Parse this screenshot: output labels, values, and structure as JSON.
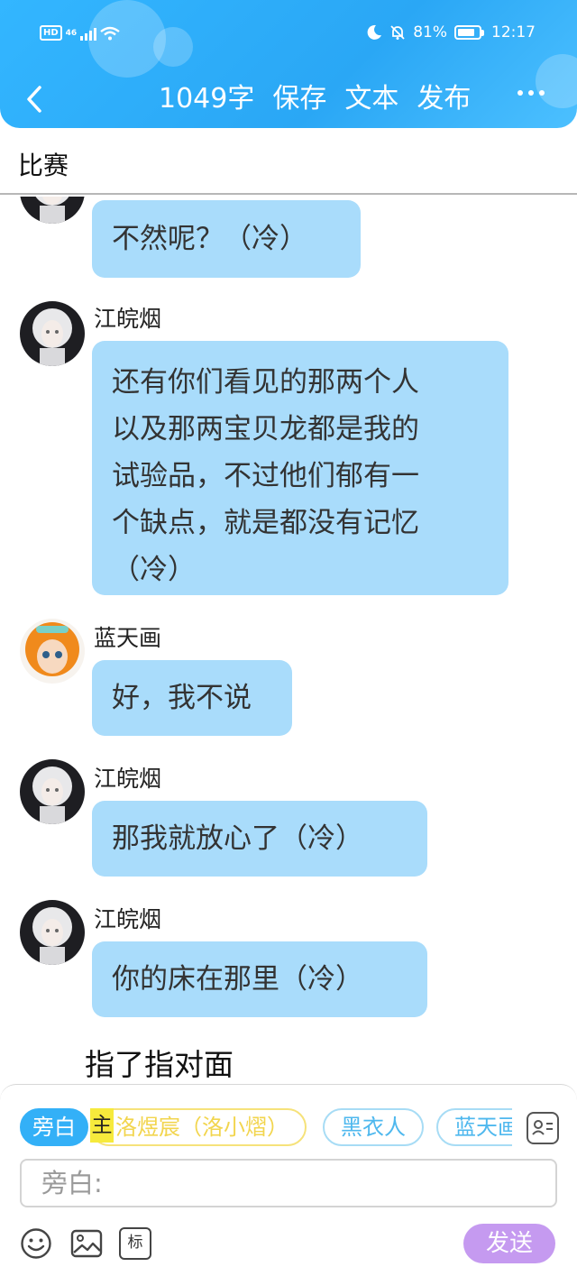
{
  "status_bar": {
    "hd": "HD",
    "network": "46",
    "battery_percent": "81%",
    "battery_level": 0.81,
    "time": "12:17"
  },
  "toolbar": {
    "word_count": "1049字",
    "save_label": "保存",
    "text_label": "文本",
    "publish_label": "发布"
  },
  "page_title": "比赛",
  "messages": [
    {
      "name": "",
      "text": "不然呢？（冷）"
    },
    {
      "name": "江皖烟",
      "lines": [
        "还有你们看见的那两个人",
        "以及那两宝贝龙都是我的",
        "试验品，不过他们郁有一",
        "个缺点，就是都没有记忆",
        "（冷）"
      ]
    },
    {
      "name": "蓝天画",
      "text": "好，我不说"
    },
    {
      "name": "江皖烟",
      "text": "那我就放心了（冷）"
    },
    {
      "name": "江皖烟",
      "text": "你的床在那里（冷）"
    }
  ],
  "narration": "指了指对面",
  "input_panel": {
    "roles": {
      "active": "旁白",
      "main_tag": "主",
      "main_role": "洛煜宸（洛小熠）",
      "role_3": "黑衣人",
      "role_4": "蓝天画"
    },
    "input_placeholder": "旁白:",
    "mark_label": "标",
    "send_label": "发送"
  },
  "colors": {
    "header": "#2aa7f5",
    "bubble": "#a9dcfb",
    "send": "#c59af0",
    "main_chip": "#f6e27a"
  }
}
